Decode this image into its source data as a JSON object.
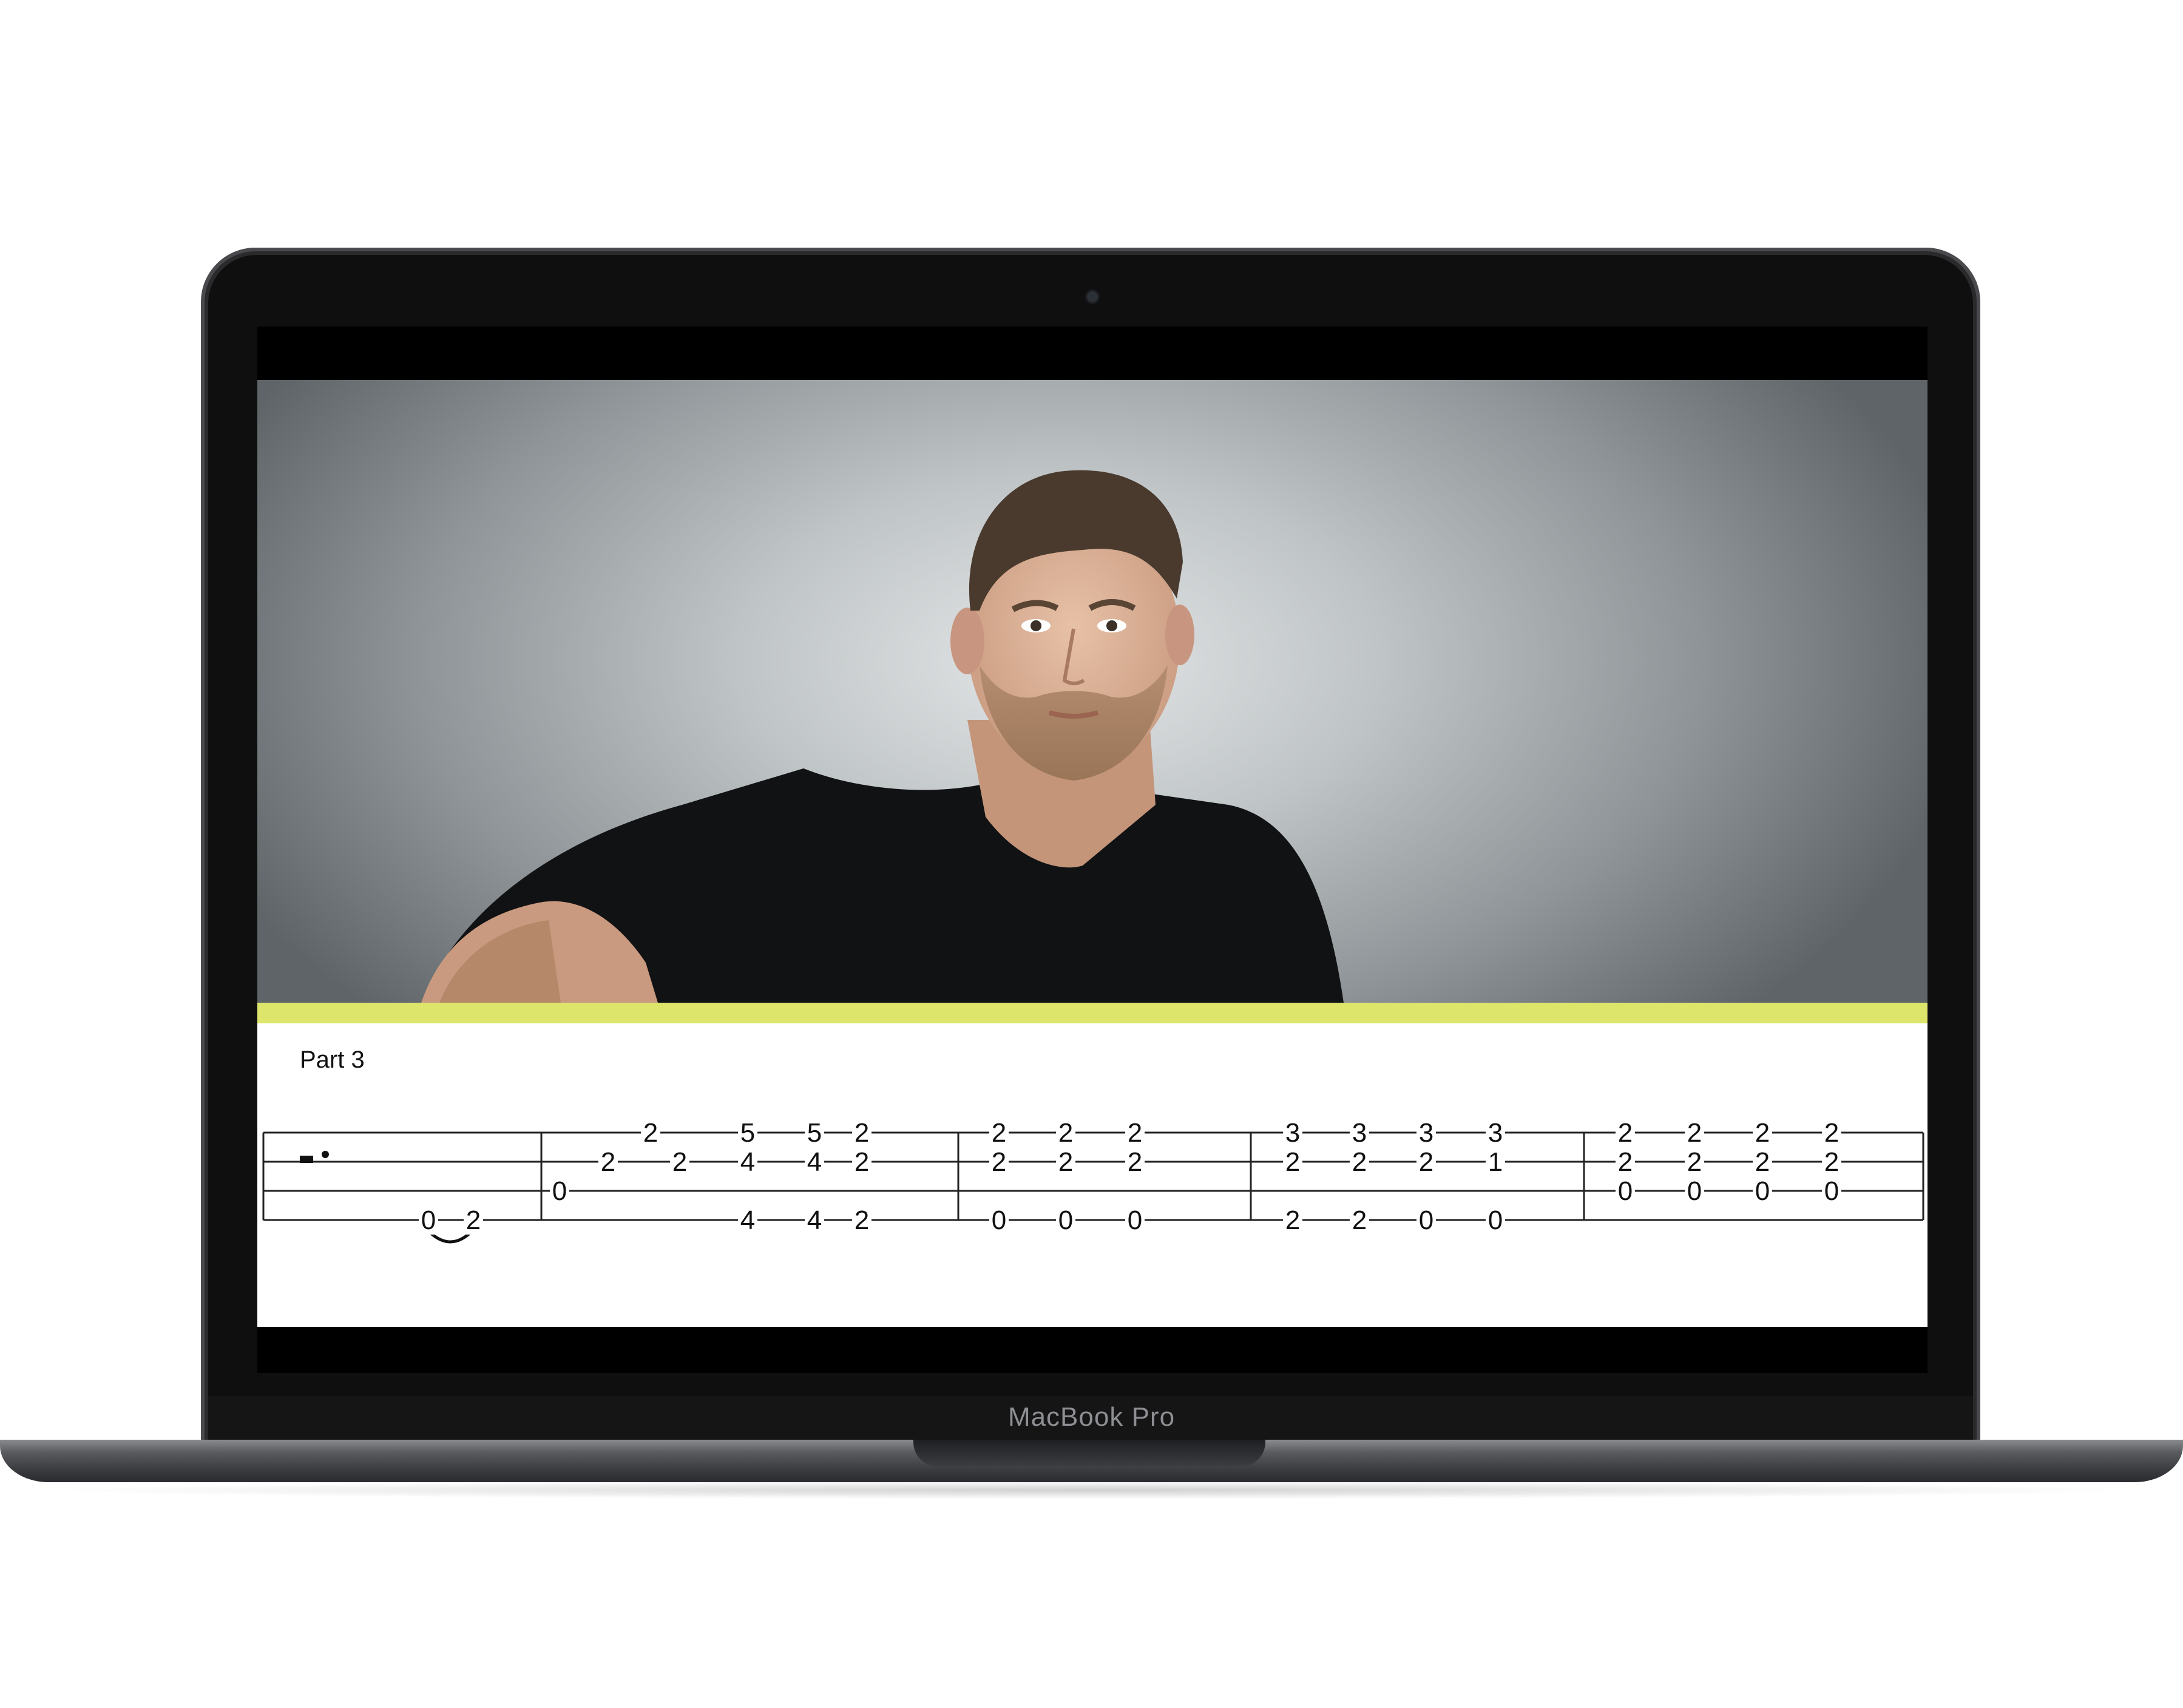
{
  "device": {
    "brand_label": "MacBook Pro"
  },
  "lesson": {
    "section_label": "Part 3"
  },
  "tab": {
    "measures": [
      {
        "notes": [
          {
            "string": 4,
            "fret": "0"
          },
          {
            "string": 4,
            "fret": "2"
          }
        ]
      },
      {
        "notes": [
          {
            "string": 3,
            "fret": "0"
          },
          {
            "string": 2,
            "fret": "2"
          },
          {
            "string": 1,
            "fret": "2"
          },
          {
            "string": 2,
            "fret": "2"
          },
          {
            "string": 1,
            "fret": "5"
          },
          {
            "string": 2,
            "fret": "4"
          },
          {
            "string": 4,
            "fret": "4"
          },
          {
            "string": 1,
            "fret": "5"
          },
          {
            "string": 2,
            "fret": "4"
          },
          {
            "string": 4,
            "fret": "4"
          },
          {
            "string": 1,
            "fret": "2"
          },
          {
            "string": 2,
            "fret": "2"
          },
          {
            "string": 4,
            "fret": "2"
          }
        ]
      },
      {
        "notes": [
          {
            "string": 1,
            "fret": "2"
          },
          {
            "string": 2,
            "fret": "2"
          },
          {
            "string": 4,
            "fret": "0"
          },
          {
            "string": 1,
            "fret": "2"
          },
          {
            "string": 2,
            "fret": "2"
          },
          {
            "string": 4,
            "fret": "0"
          },
          {
            "string": 1,
            "fret": "2"
          },
          {
            "string": 2,
            "fret": "2"
          },
          {
            "string": 4,
            "fret": "0"
          }
        ]
      },
      {
        "notes": [
          {
            "string": 1,
            "fret": "3"
          },
          {
            "string": 2,
            "fret": "2"
          },
          {
            "string": 4,
            "fret": "2"
          },
          {
            "string": 1,
            "fret": "3"
          },
          {
            "string": 2,
            "fret": "2"
          },
          {
            "string": 4,
            "fret": "2"
          },
          {
            "string": 1,
            "fret": "3"
          },
          {
            "string": 2,
            "fret": "2"
          },
          {
            "string": 4,
            "fret": "0"
          },
          {
            "string": 1,
            "fret": "3"
          },
          {
            "string": 2,
            "fret": "1"
          },
          {
            "string": 4,
            "fret": "0"
          }
        ]
      },
      {
        "notes": [
          {
            "string": 1,
            "fret": "2"
          },
          {
            "string": 2,
            "fret": "2"
          },
          {
            "string": 3,
            "fret": "0"
          },
          {
            "string": 1,
            "fret": "2"
          },
          {
            "string": 2,
            "fret": "2"
          },
          {
            "string": 3,
            "fret": "0"
          },
          {
            "string": 1,
            "fret": "2"
          },
          {
            "string": 2,
            "fret": "2"
          },
          {
            "string": 3,
            "fret": "0"
          },
          {
            "string": 1,
            "fret": "2"
          },
          {
            "string": 2,
            "fret": "2"
          },
          {
            "string": 3,
            "fret": "0"
          }
        ]
      }
    ]
  }
}
